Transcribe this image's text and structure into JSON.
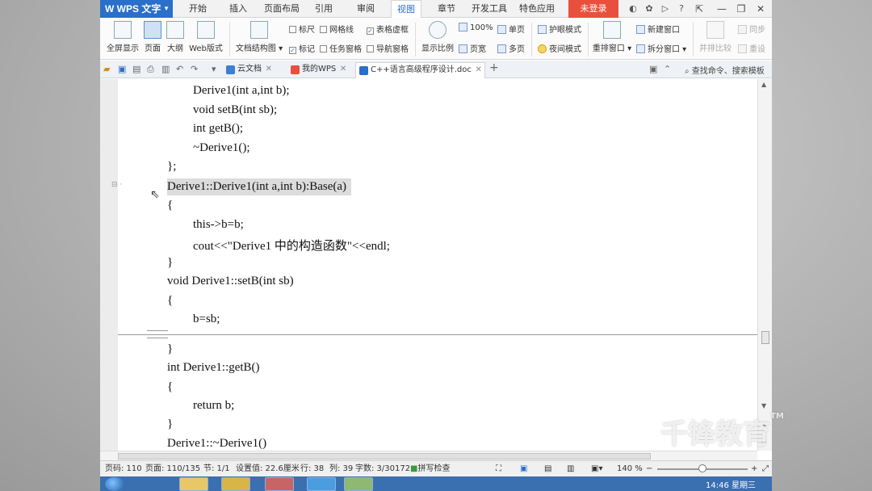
{
  "app": {
    "name": "WPS 文字"
  },
  "menu": {
    "tabs": [
      "开始",
      "插入",
      "页面布局",
      "引用",
      "审阅",
      "视图",
      "章节",
      "开发工具",
      "特色应用"
    ],
    "active_tab": "视图",
    "login": "未登录",
    "help": "?"
  },
  "ribbon": {
    "full_screen": "全屏显示",
    "page": "页面",
    "outline": "大纲",
    "web_layout": "Web版式",
    "doc_structure": "文档结构图",
    "ruler": "标尺",
    "gridlines": "网格线",
    "table_gridlines": "表格虚框",
    "marks": "标记",
    "task_pane": "任务窗格",
    "nav_pane": "导航窗格",
    "zoom_label": "显示比例",
    "zoom_100": "100%",
    "single_page": "单页",
    "page_width": "页宽",
    "multi_page": "多页",
    "eye_mode": "护眼模式",
    "night_mode": "夜间模式",
    "rearrange": "重排窗口",
    "new_window": "新建窗口",
    "split_window": "拆分窗口",
    "side_by_side": "并排比较",
    "sync": "同步",
    "reset": "重设"
  },
  "tabbar": {
    "tabs": [
      {
        "label": "云文档",
        "icon": "cloud-icon"
      },
      {
        "label": "我的WPS",
        "icon": "wps-icon"
      },
      {
        "label": "C++语言高级程序设计.doc",
        "icon": "doc-icon"
      }
    ],
    "new_tab": "+",
    "search_cmd": "查找命令、搜索模板"
  },
  "document": {
    "lines": [
      "Derive1(int a,int b);",
      "void setB(int sb);",
      "int getB();",
      "~Derive1();",
      "};",
      "Derive1::Derive1(int a,int b):Base(a)",
      "{",
      "this->b=b;",
      "cout<<\"Derive1 中的构造函数\"<<endl;",
      "}",
      "void Derive1::setB(int sb)",
      "{",
      "b=sb;",
      "}",
      "int Derive1::getB()",
      "{",
      "return b;",
      "}",
      "Derive1::~Derive1()"
    ]
  },
  "status": {
    "page_num": "页码: 110",
    "pages": "页面: 110/135",
    "section": "节: 1/1",
    "setting": "设置值: 22.6厘米",
    "row": "行: 38",
    "col": "列: 39",
    "words": "字数: 3/30172",
    "spell": "拼写检查",
    "zoom": "140 %",
    "zoom_level": 0.5
  },
  "taskbar": {
    "time": "14:46",
    "weekday": "星期三"
  },
  "watermark": {
    "text": "千锋教育",
    "tm": "TM"
  },
  "colors": {
    "accent": "#2a6fc9",
    "login": "#e94f3d",
    "highlight": "#dcdcdc"
  }
}
